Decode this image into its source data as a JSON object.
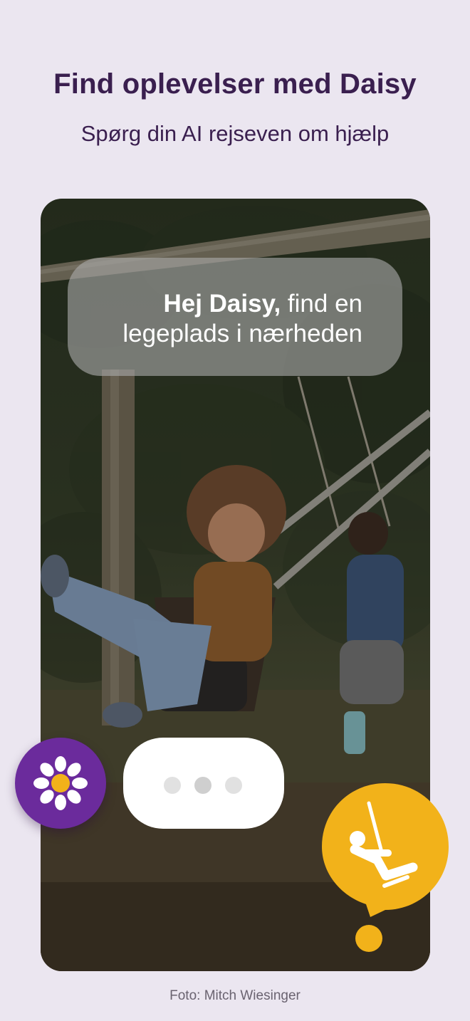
{
  "header": {
    "title": "Find oplevelser med Daisy",
    "subtitle": "Spørg din AI rejseven om hjælp"
  },
  "chat": {
    "user_message_bold": "Hej Daisy,",
    "user_message_rest": " find en legeplads i nærheden",
    "typing_indicator_dots": 3
  },
  "icons": {
    "assistant": "daisy-flower-icon",
    "category": "swing-playground-icon"
  },
  "colors": {
    "background": "#ebe6f0",
    "title": "#3a1f4f",
    "daisy_purple": "#6b2b9c",
    "pin_yellow": "#f2b21a"
  },
  "footer": {
    "photo_credit": "Foto: Mitch Wiesinger"
  }
}
